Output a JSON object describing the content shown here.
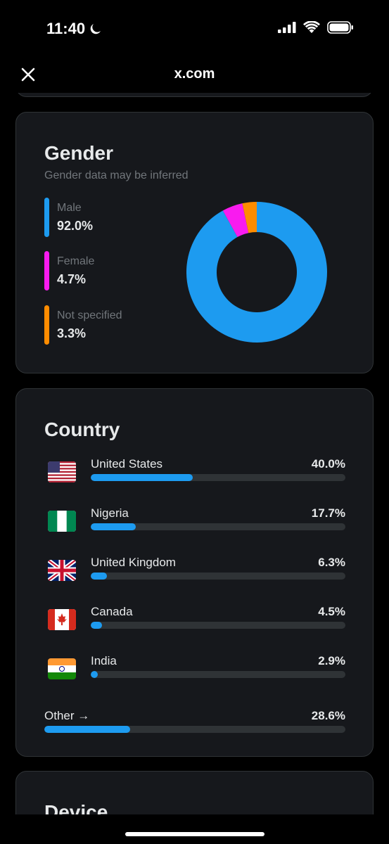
{
  "status_bar": {
    "time": "11:40"
  },
  "nav": {
    "title": "x.com"
  },
  "gender": {
    "title": "Gender",
    "subtitle": "Gender data may be inferred",
    "items": [
      {
        "label": "Male",
        "value": "92.0%",
        "pct": 92.0,
        "color": "#1d9bf0"
      },
      {
        "label": "Female",
        "value": "4.7%",
        "pct": 4.7,
        "color": "#f91bef"
      },
      {
        "label": "Not specified",
        "value": "3.3%",
        "pct": 3.3,
        "color": "#ff8c00"
      }
    ]
  },
  "country": {
    "title": "Country",
    "items": [
      {
        "name": "United States",
        "value": "40.0%",
        "pct": 40.0,
        "flag": "us-flag"
      },
      {
        "name": "Nigeria",
        "value": "17.7%",
        "pct": 17.7,
        "flag": "nigeria-flag"
      },
      {
        "name": "United Kingdom",
        "value": "6.3%",
        "pct": 6.3,
        "flag": "uk-flag"
      },
      {
        "name": "Canada",
        "value": "4.5%",
        "pct": 4.5,
        "flag": "canada-flag"
      },
      {
        "name": "India",
        "value": "2.9%",
        "pct": 2.9,
        "flag": "india-flag"
      }
    ],
    "other": {
      "label": "Other →",
      "value": "28.6%",
      "pct": 28.6
    },
    "bar_color": "#1d9bf0"
  },
  "device": {
    "title": "Device"
  },
  "chart_data": {
    "type": "pie",
    "title": "Gender",
    "categories": [
      "Male",
      "Female",
      "Not specified"
    ],
    "values": [
      92.0,
      4.7,
      3.3
    ]
  }
}
